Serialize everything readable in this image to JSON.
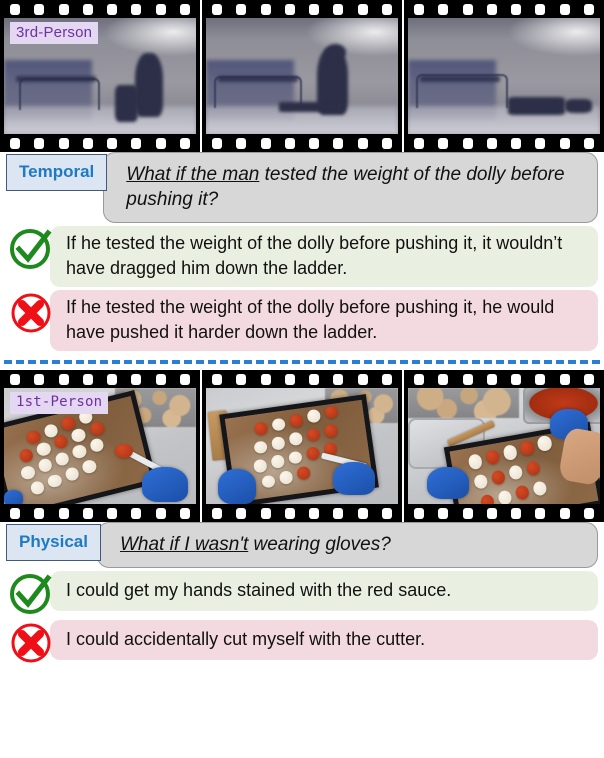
{
  "examples": [
    {
      "view_tag": "3rd-Person",
      "category": "Temporal",
      "question_underlined": "What if the man",
      "question_rest": " tested the weight of the dolly before pushing it?",
      "correct_answer": "If he tested the weight of the dolly before pushing it, it wouldn’t have dragged him down the ladder.",
      "incorrect_answer": "If he tested the weight of the dolly before pushing it, he would have pushed it harder down the ladder."
    },
    {
      "view_tag": "1st-Person",
      "category": "Physical",
      "question_underlined": "What if I wasn't",
      "question_rest": " wearing gloves?",
      "correct_answer": "I could get my hands stained with the red sauce.",
      "incorrect_answer": "I could accidentally cut myself with the cutter."
    }
  ],
  "icons": {
    "correct": "check-circle-icon",
    "incorrect": "x-circle-icon"
  },
  "colors": {
    "badge_bg": "#dce6f2",
    "badge_border": "#41597c",
    "badge_text": "#1f7ac4",
    "question_bg": "#d7d7d7",
    "correct_bg": "#e9f0e1",
    "incorrect_bg": "#f3dae0",
    "correct_icon": "#1e8a1e",
    "incorrect_icon": "#ee0f17",
    "divider": "#2a7fd4",
    "tag_bg": "#e3d7f2",
    "tag_text": "#7030a0"
  }
}
